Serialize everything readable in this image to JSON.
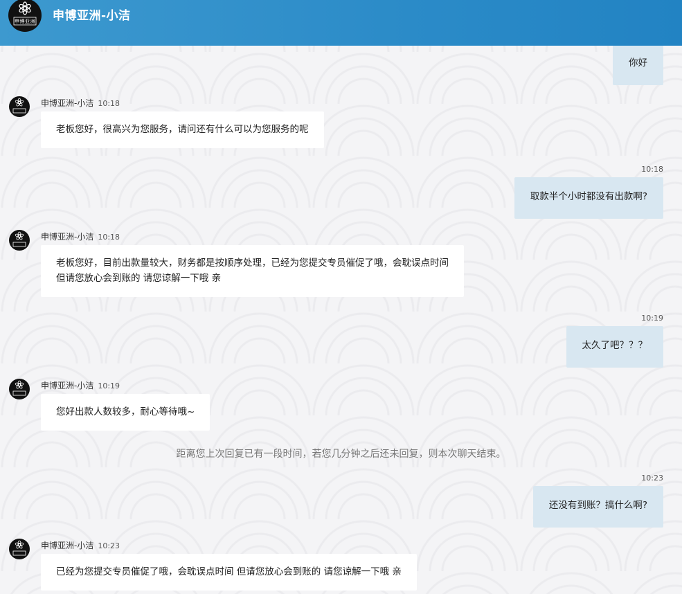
{
  "header": {
    "title": "申博亚洲-小洁",
    "logo_text": "申博亚洲"
  },
  "agent_name": "申博亚洲-小洁",
  "messages": [
    {
      "side": "out",
      "time": "",
      "lines": [
        "你好"
      ]
    },
    {
      "side": "in",
      "time": "10:18",
      "lines": [
        "老板您好，很高兴为您服务，请问还有什么可以为您服务的呢"
      ]
    },
    {
      "side": "out",
      "time": "10:18",
      "lines": [
        "取款半个小时都没有出款啊?"
      ]
    },
    {
      "side": "in",
      "time": "10:18",
      "lines": [
        "老板您好，目前出款量较大，财务都是按顺序处理，已经为您提交专员催促了哦，会耽误点时间",
        "但请您放心会到账的 请您谅解一下哦 亲"
      ]
    },
    {
      "side": "out",
      "time": "10:19",
      "lines": [
        "太久了吧？？？"
      ]
    },
    {
      "side": "in",
      "time": "10:19",
      "lines": [
        "您好出款人数较多，耐心等待哦~"
      ]
    },
    {
      "side": "out",
      "time": "10:23",
      "lines": [
        "还没有到账？搞什么啊?"
      ]
    },
    {
      "side": "in",
      "time": "10:23",
      "lines": [
        "已经为您提交专员催促了哦，会耽误点时间 但请您放心会到账的 请您谅解一下哦 亲"
      ]
    }
  ],
  "notice": "距离您上次回复已有一段时间，若您几分钟之后还未回复，则本次聊天结束。",
  "colors": {
    "header": "#2b8bc8",
    "outgoing_bubble": "#d8e7f1",
    "incoming_bubble": "#ffffff"
  }
}
